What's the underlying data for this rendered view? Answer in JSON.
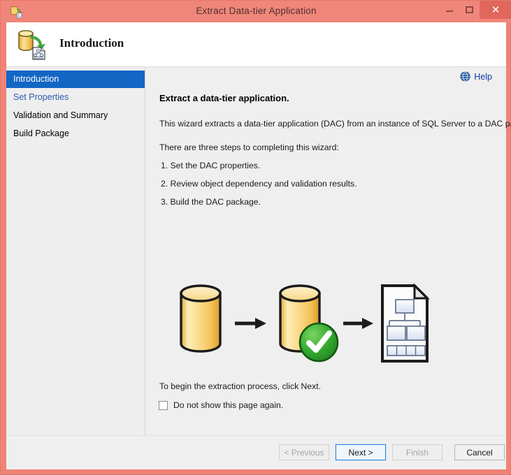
{
  "window": {
    "title": "Extract Data-tier Application",
    "icon": "extract-dac-icon",
    "controls": {
      "minimize": "minimize-icon",
      "maximize": "maximize-icon",
      "close": "✕"
    },
    "accent_color": "#f0867a",
    "close_button_color": "#e1675d"
  },
  "header": {
    "title": "Introduction",
    "icon": "database-to-document-icon"
  },
  "sidebar": {
    "items": [
      {
        "label": "Introduction",
        "state": "selected"
      },
      {
        "label": "Set Properties",
        "state": "link"
      },
      {
        "label": "Validation and Summary",
        "state": "normal"
      },
      {
        "label": "Build Package",
        "state": "normal"
      }
    ],
    "selected_color": "#1366c4",
    "link_color": "#2a5db0"
  },
  "content": {
    "help": {
      "label": "Help",
      "icon": "help-globe-icon",
      "color": "#14389c"
    },
    "heading": "Extract a data-tier application.",
    "intro": "This wizard extracts a data-tier application (DAC) from an instance of SQL Server to a DAC package.",
    "steps_lead": "There are three steps to completing this wizard:",
    "steps": [
      "1. Set the DAC properties.",
      "2. Review object dependency and validation results.",
      "3. Build the DAC package."
    ],
    "begin_text": "To begin the extraction process, click Next.",
    "checkbox": {
      "label": "Do not show this page again.",
      "checked": false
    },
    "illustration": {
      "nodes": [
        "database-icon",
        "arrow-right-icon",
        "database-validated-icon",
        "arrow-right-icon",
        "dac-package-document-icon"
      ],
      "database_color": "#f5c860",
      "check_color": "#2fa02f"
    }
  },
  "buttons": [
    {
      "id": "previous",
      "label": "< Previous",
      "state": "disabled"
    },
    {
      "id": "next",
      "label": "Next >",
      "state": "focused"
    },
    {
      "id": "finish",
      "label": "Finish",
      "state": "disabled"
    },
    {
      "id": "cancel",
      "label": "Cancel",
      "state": "enabled"
    }
  ]
}
